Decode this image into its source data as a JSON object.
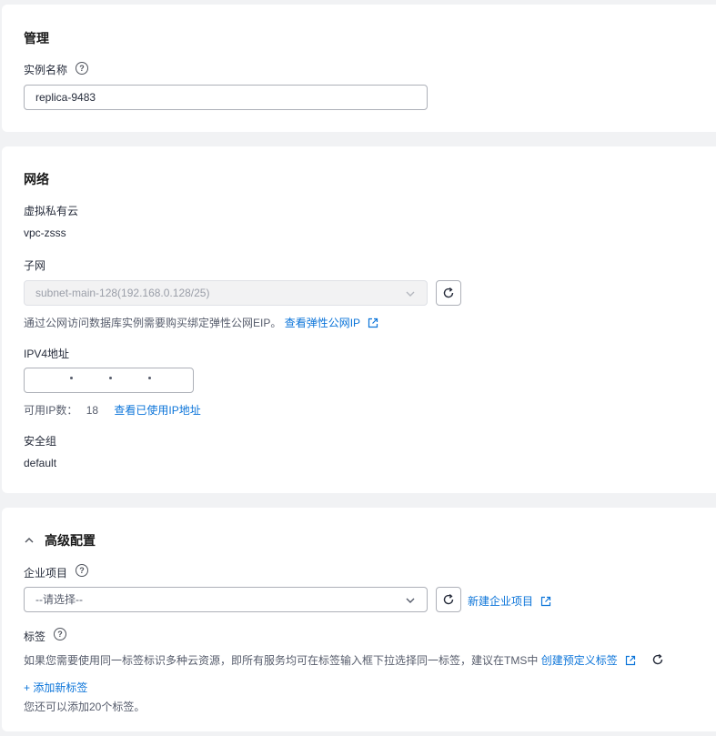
{
  "management": {
    "title": "管理",
    "instance_name_label": "实例名称",
    "instance_name_value": "replica-9483"
  },
  "network": {
    "title": "网络",
    "vpc_label": "虚拟私有云",
    "vpc_value": "vpc-zsss",
    "subnet_label": "子网",
    "subnet_value": "subnet-main-128(192.168.0.128/25)",
    "eip_hint": "通过公网访问数据库实例需要购买绑定弹性公网EIP。",
    "eip_link": "查看弹性公网IP",
    "ipv4_label": "IPV4地址",
    "available_ip_label": "可用IP数：",
    "available_ip_count": "18",
    "used_ip_link": "查看已使用IP地址",
    "security_group_label": "安全组",
    "security_group_value": "default"
  },
  "advanced": {
    "title": "高级配置",
    "enterprise_project_label": "企业项目",
    "enterprise_project_placeholder": "--请选择--",
    "new_enterprise_project_link": "新建企业项目",
    "tags_label": "标签",
    "tags_hint": "如果您需要使用同一标签标识多种云资源，即所有服务均可在标签输入框下拉选择同一标签，建议在TMS中",
    "create_tag_link": "创建预定义标签",
    "add_tag_link": "+ 添加新标签",
    "tags_remaining": "您还可以添加20个标签。"
  },
  "icons": {
    "help": "question-circle-icon",
    "refresh": "refresh-icon",
    "external": "external-link-icon",
    "chevron": "chevron-down-icon",
    "collapse": "chevron-up-icon"
  },
  "colors": {
    "link": "#0b74d9",
    "background": "#f1f2f4",
    "card": "#ffffff"
  }
}
